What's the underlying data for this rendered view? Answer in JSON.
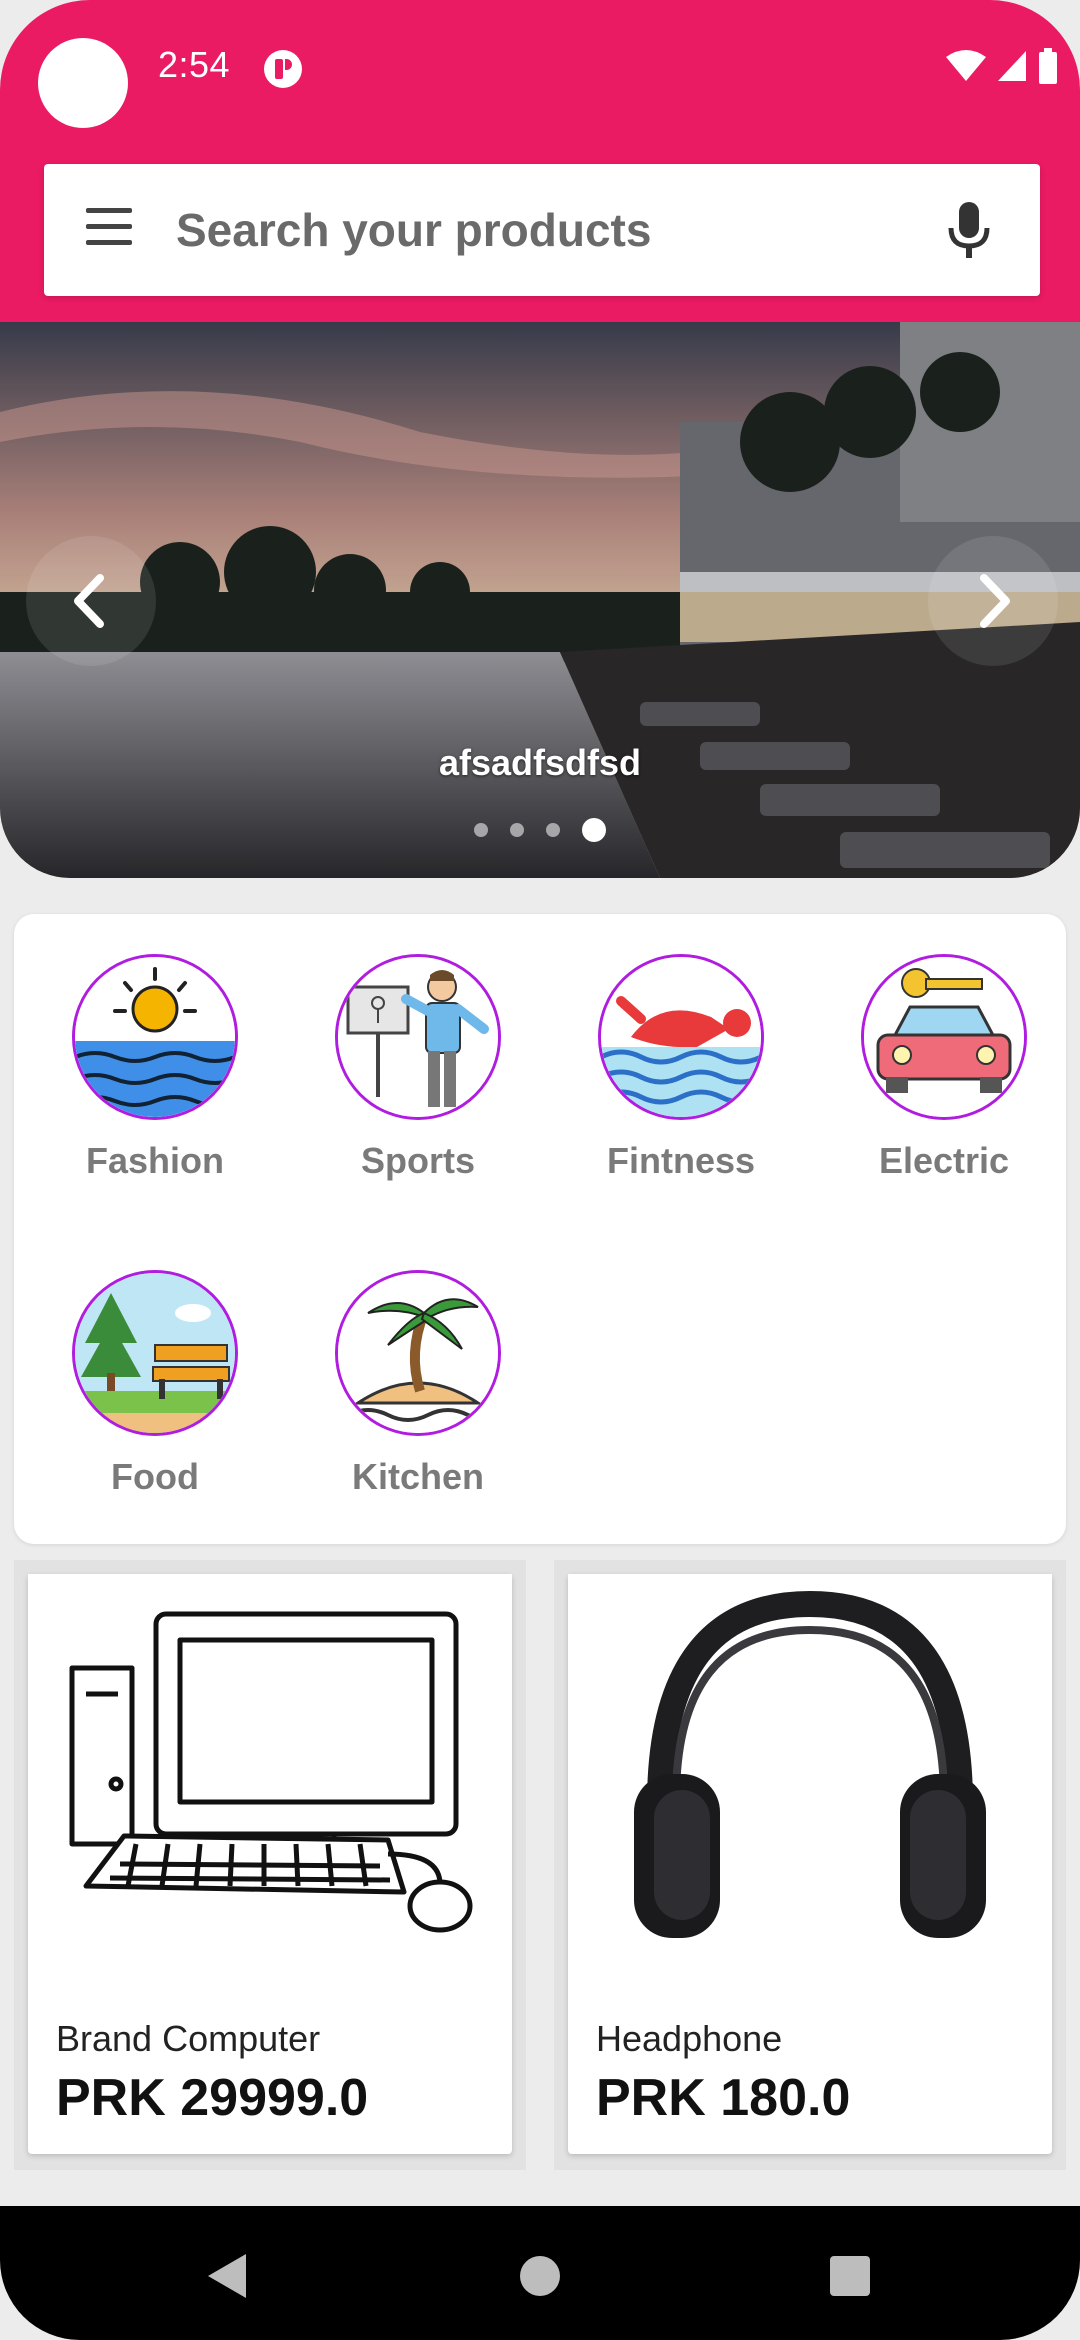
{
  "status_bar": {
    "time": "2:54"
  },
  "search": {
    "placeholder": "Search your products"
  },
  "carousel": {
    "caption": "afsadfsdfsd",
    "slide_count": 4,
    "active_index": 3
  },
  "categories": [
    {
      "label": "Fashion",
      "icon": "beach-sun-icon"
    },
    {
      "label": "Sports",
      "icon": "teacher-board-icon"
    },
    {
      "label": "Fintness",
      "icon": "swimmer-icon"
    },
    {
      "label": "Electric",
      "icon": "car-key-icon"
    },
    {
      "label": "Food",
      "icon": "park-bench-icon"
    },
    {
      "label": "Kitchen",
      "icon": "palm-island-icon"
    }
  ],
  "products": [
    {
      "name": "Brand Computer",
      "price": "PRK 29999.0",
      "image": "computer-sketch-image"
    },
    {
      "name": "Headphone",
      "price": "PRK 180.0",
      "image": "headphone-image"
    }
  ],
  "colors": {
    "brand": "#ea1a63",
    "category_ring": "#b01ce0",
    "background": "#ececec"
  }
}
